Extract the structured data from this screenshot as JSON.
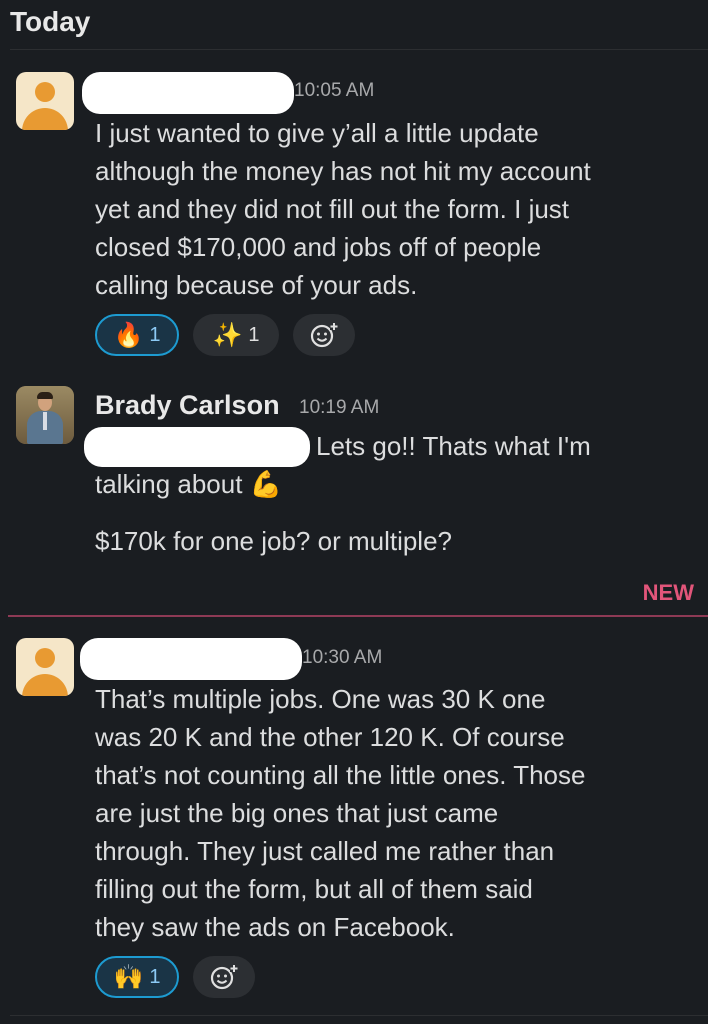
{
  "day_header": "Today",
  "new_label": "NEW",
  "messages": [
    {
      "time": "10:05 AM",
      "lines": [
        "I just wanted to give y’all a little update",
        "although the money has not hit my account",
        "yet and they did not fill out the form. I just",
        "closed $170,000 and jobs off of people",
        "calling because of your ads."
      ],
      "reactions": [
        {
          "emoji": "🔥",
          "count": "1",
          "active": true
        },
        {
          "emoji": "✨",
          "count": "1",
          "active": false
        }
      ],
      "add_reaction_icon": "add-emoji"
    },
    {
      "name": "Brady Carlson",
      "time": "10:19 AM",
      "first_line": "Lets go!! Thats what I'm",
      "second_line": "talking about",
      "second_line_emoji": "💪",
      "question": "$170k for one job? or multiple?"
    },
    {
      "time": "10:30 AM",
      "lines": [
        "That’s multiple jobs. One was 30 K one",
        "was 20 K and the other 120 K. Of course",
        "that’s not counting all the little ones. Those",
        "are just the big ones that just came",
        "through. They just called me rather than",
        "filling out the form, but all of them said",
        "they saw the ads on Facebook."
      ],
      "reactions": [
        {
          "emoji": "🙌",
          "count": "1",
          "active": true
        }
      ],
      "add_reaction_icon": "add-emoji"
    }
  ]
}
